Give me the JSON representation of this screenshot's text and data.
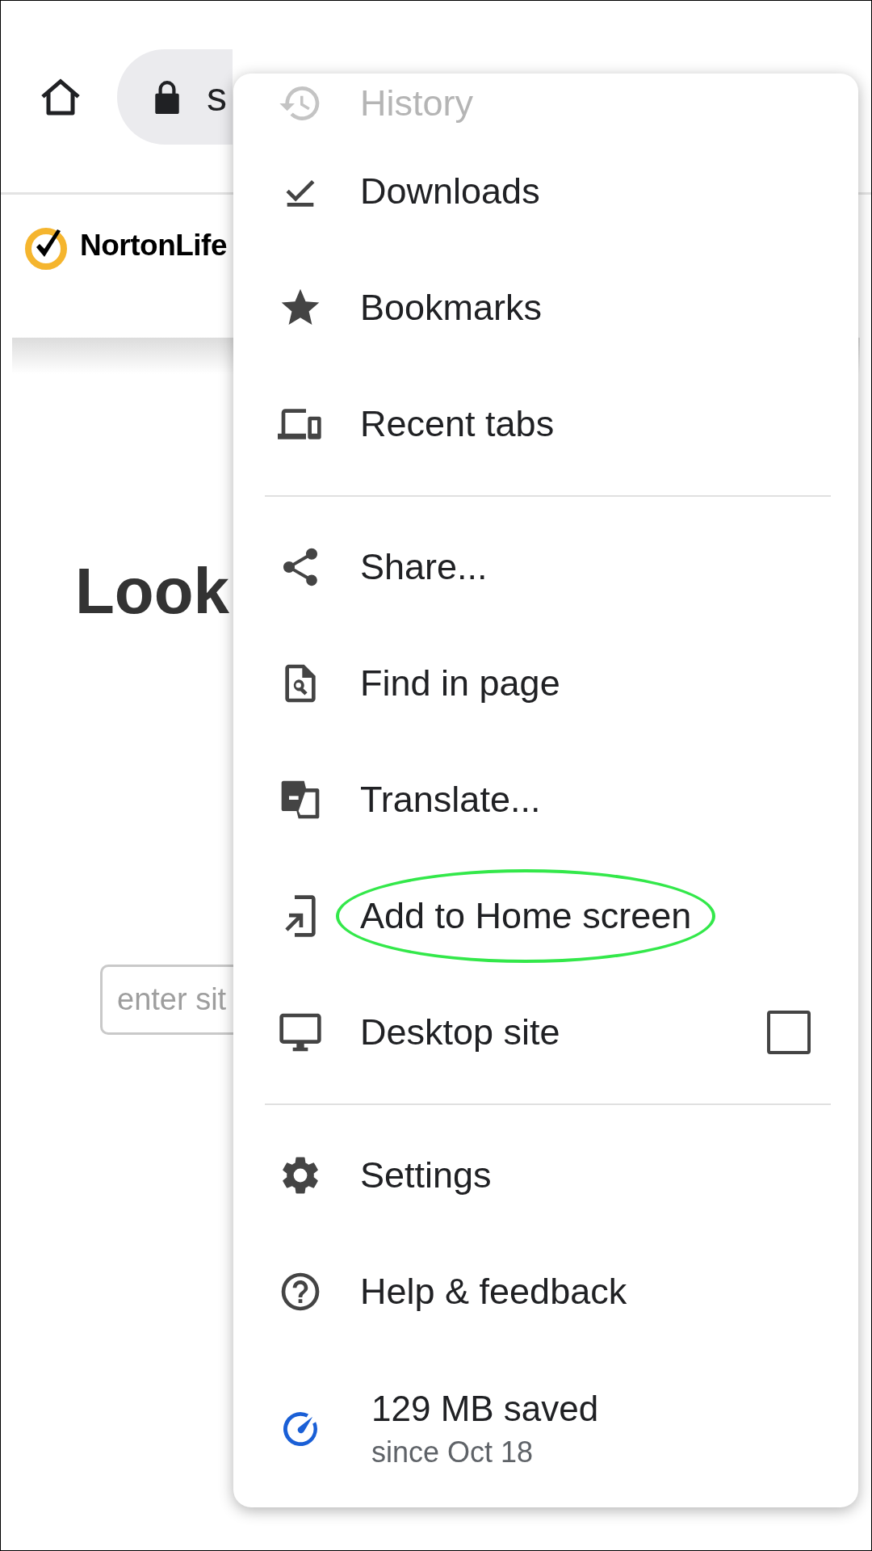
{
  "toolbar": {
    "url_text": "s"
  },
  "page": {
    "logo_text": "NortonLife",
    "heading": "Look",
    "site_field": {
      "placeholder": "enter sit"
    }
  },
  "menu": {
    "items": [
      {
        "kind": "item",
        "label": "History",
        "faded": true
      },
      {
        "kind": "item",
        "label": "Downloads",
        "faded": false
      },
      {
        "kind": "item",
        "label": "Bookmarks",
        "faded": false
      },
      {
        "kind": "item",
        "label": "Recent tabs",
        "faded": false
      },
      {
        "kind": "divider"
      },
      {
        "kind": "item",
        "label": "Share...",
        "faded": false
      },
      {
        "kind": "item",
        "label": "Find in page",
        "faded": false
      },
      {
        "kind": "item",
        "label": "Translate...",
        "faded": false
      },
      {
        "kind": "item",
        "label": "Add to Home screen",
        "faded": false,
        "highlighted": true
      },
      {
        "kind": "checkbox",
        "label": "Desktop site",
        "checked": false
      },
      {
        "kind": "divider"
      },
      {
        "kind": "item",
        "label": "Settings",
        "faded": false
      },
      {
        "kind": "item",
        "label": "Help & feedback",
        "faded": false
      },
      {
        "kind": "stat",
        "label": "129 MB saved",
        "sublabel": "since Oct 18"
      }
    ]
  }
}
